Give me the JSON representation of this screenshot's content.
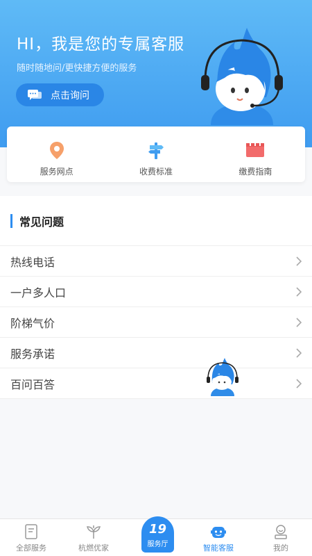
{
  "hero": {
    "title": "HI，我是您的专属客服",
    "subtitle": "随时随地问/更快捷方便的服务",
    "ask_button": "点击询问"
  },
  "quick_links": [
    {
      "label": "服务网点",
      "icon": "location-pin-icon"
    },
    {
      "label": "收费标准",
      "icon": "signpost-icon"
    },
    {
      "label": "缴费指南",
      "icon": "calendar-card-icon"
    }
  ],
  "faq": {
    "title": "常见问题",
    "items": [
      "热线电话",
      "一户多人口",
      "阶梯气价",
      "服务承诺",
      "百问百答"
    ]
  },
  "tabbar": {
    "tabs": [
      {
        "label": "全部服务",
        "icon": "document-icon"
      },
      {
        "label": "杭燃优家",
        "icon": "sprout-icon"
      },
      {
        "label": "服务厅",
        "icon": "badge-19-icon",
        "badge": "19"
      },
      {
        "label": "智能客服",
        "icon": "robot-face-icon"
      },
      {
        "label": "我的",
        "icon": "user-icon"
      }
    ],
    "active": "智能客服"
  },
  "colors": {
    "primary": "#2d8df0",
    "hero_top": "#5fbaf6",
    "hero_bottom": "#3f9cf0",
    "pin": "#f6a06a",
    "card_red": "#f26b6b"
  }
}
